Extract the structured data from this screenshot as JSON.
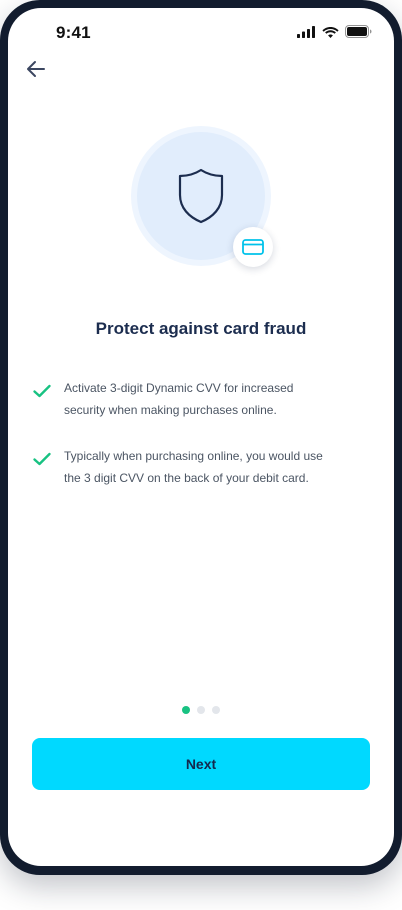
{
  "status_bar": {
    "time": "9:41",
    "icons": [
      "signal-icon",
      "wifi-icon",
      "battery-icon"
    ]
  },
  "header": {
    "back_icon": "arrow-left-icon"
  },
  "illustration": {
    "main_icon": "shield-icon",
    "badge_icon": "credit-card-icon"
  },
  "content": {
    "title": "Protect against card fraud",
    "features": [
      {
        "icon": "check-icon",
        "text": "Activate 3-digit Dynamic CVV for increased security when making purchases online."
      },
      {
        "icon": "check-icon",
        "text": "Typically when purchasing online, you would use the 3 digit CVV on the back of your debit card."
      }
    ]
  },
  "pagination": {
    "total": 3,
    "active_index": 0
  },
  "actions": {
    "next_label": "Next"
  },
  "colors": {
    "accent": "#00d9ff",
    "success": "#18c282",
    "title_text": "#1c2d4f",
    "device_frame": "#121c2e"
  }
}
